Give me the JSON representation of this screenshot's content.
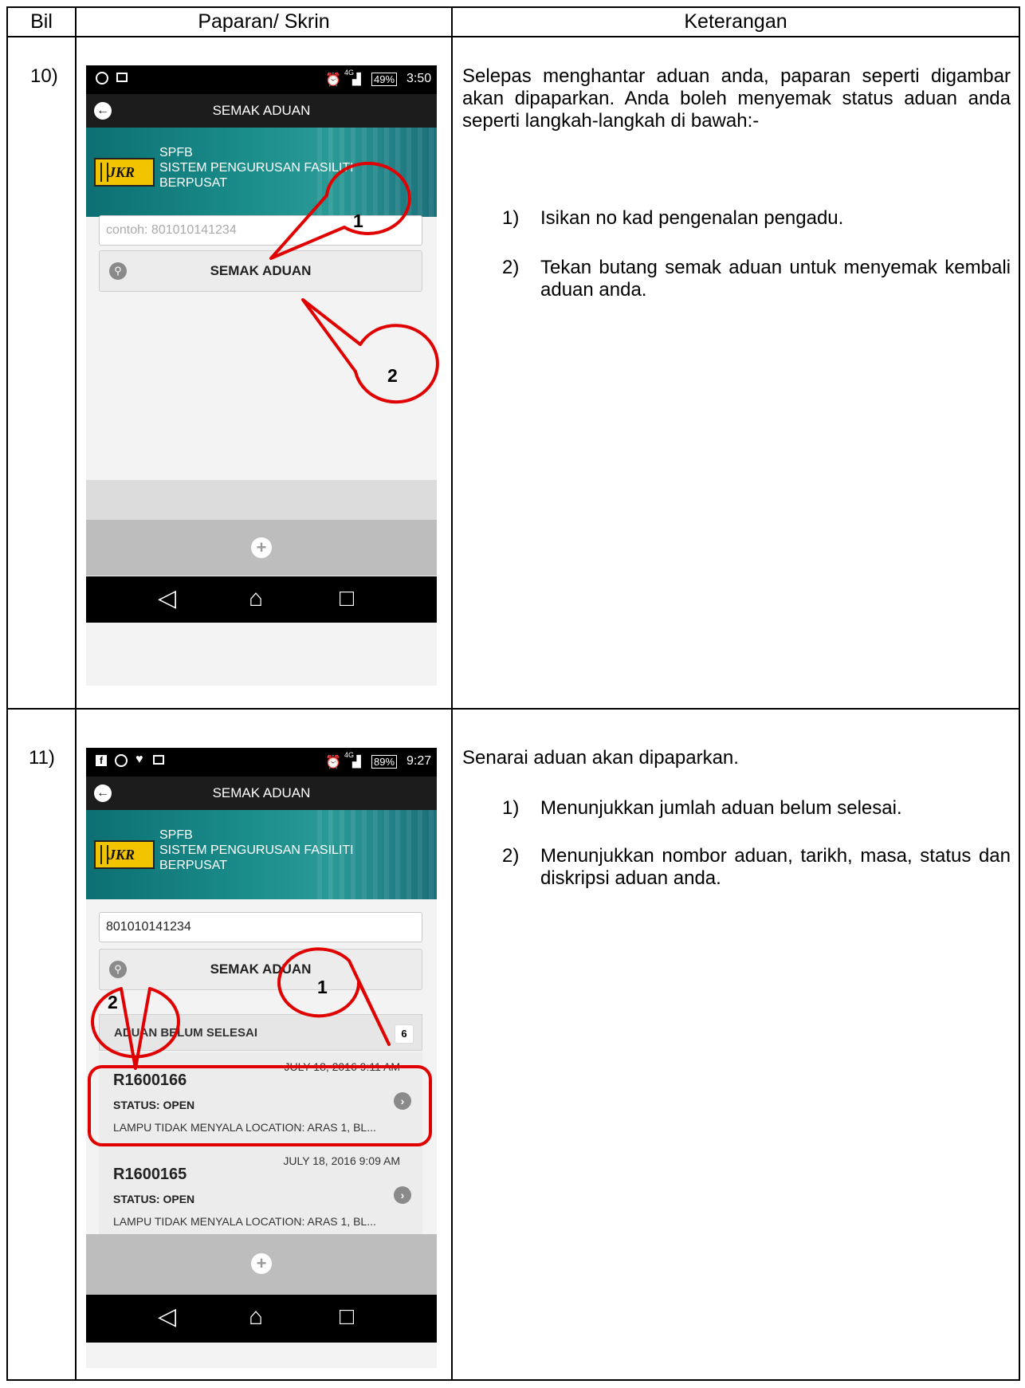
{
  "table": {
    "headers": [
      "Bil",
      "Paparan/ Skrin",
      "Keterangan"
    ],
    "rows": [
      {
        "bil": "10)",
        "description": "Selepas menghantar aduan anda, paparan seperti digambar akan dipaparkan. Anda boleh menyemak status aduan anda seperti langkah-langkah di bawah:-",
        "steps": [
          {
            "num": "1)",
            "text": "Isikan no kad pengenalan pengadu."
          },
          {
            "num": "2)",
            "text": "Tekan butang semak aduan untuk menyemak kembali aduan anda."
          }
        ]
      },
      {
        "bil": "11)",
        "description": "Senarai aduan akan dipaparkan.",
        "steps": [
          {
            "num": "1)",
            "text": "Menunjukkan jumlah aduan belum selesai."
          },
          {
            "num": "2)",
            "text": "Menunjukkan nombor aduan, tarikh, masa, status dan diskripsi aduan anda."
          }
        ]
      }
    ]
  },
  "phone1": {
    "status_time": "3:50",
    "battery": "49%",
    "network": "4G",
    "title": "SEMAK ADUAN",
    "banner": {
      "line1": "SPFB",
      "line2": "SISTEM PENGURUSAN FASILITI",
      "line3": "BERPUSAT",
      "logo": "JKR"
    },
    "input_placeholder": "contoh: 801010141234",
    "button_label": "SEMAK ADUAN",
    "callouts": [
      "1",
      "2"
    ]
  },
  "phone2": {
    "status_time": "9:27",
    "battery": "89%",
    "network": "4G",
    "title": "SEMAK ADUAN",
    "banner": {
      "line1": "SPFB",
      "line2": "SISTEM PENGURUSAN FASILITI",
      "line3": "BERPUSAT",
      "logo": "JKR"
    },
    "input_value": "801010141234",
    "button_label": "SEMAK ADUAN",
    "list_header": "ADUAN BELUM SELESAI",
    "list_count": "6",
    "items": [
      {
        "no": "R1600166",
        "datetime": "JULY 18, 2016 9:11 AM",
        "status": "STATUS: OPEN",
        "desc": "LAMPU TIDAK MENYALA LOCATION: ARAS 1, BL..."
      },
      {
        "no": "R1600165",
        "datetime": "JULY 18, 2016 9:09 AM",
        "status": "STATUS: OPEN",
        "desc": "LAMPU TIDAK MENYALA LOCATION: ARAS 1, BL..."
      }
    ],
    "callouts": [
      "1",
      "2"
    ]
  },
  "colors": {
    "annotation": "#e00000",
    "banner": "#1a8c8a",
    "logo": "#f2c400"
  }
}
